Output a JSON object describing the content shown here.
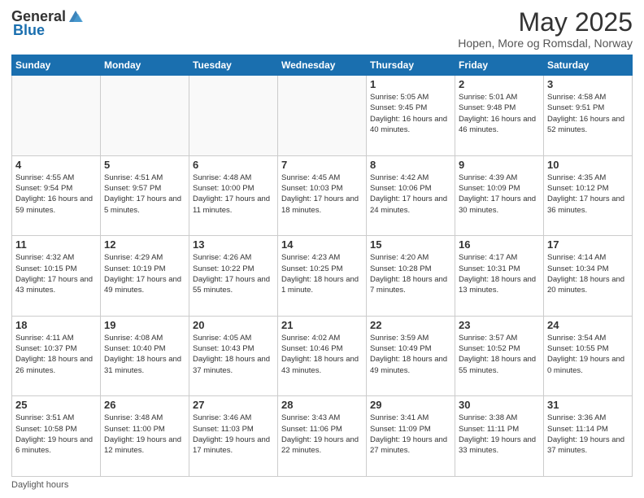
{
  "header": {
    "logo_general": "General",
    "logo_blue": "Blue",
    "title": "May 2025",
    "subtitle": "Hopen, More og Romsdal, Norway"
  },
  "calendar": {
    "days_of_week": [
      "Sunday",
      "Monday",
      "Tuesday",
      "Wednesday",
      "Thursday",
      "Friday",
      "Saturday"
    ],
    "weeks": [
      [
        {
          "day": "",
          "info": ""
        },
        {
          "day": "",
          "info": ""
        },
        {
          "day": "",
          "info": ""
        },
        {
          "day": "",
          "info": ""
        },
        {
          "day": "1",
          "info": "Sunrise: 5:05 AM\nSunset: 9:45 PM\nDaylight: 16 hours\nand 40 minutes."
        },
        {
          "day": "2",
          "info": "Sunrise: 5:01 AM\nSunset: 9:48 PM\nDaylight: 16 hours\nand 46 minutes."
        },
        {
          "day": "3",
          "info": "Sunrise: 4:58 AM\nSunset: 9:51 PM\nDaylight: 16 hours\nand 52 minutes."
        }
      ],
      [
        {
          "day": "4",
          "info": "Sunrise: 4:55 AM\nSunset: 9:54 PM\nDaylight: 16 hours\nand 59 minutes."
        },
        {
          "day": "5",
          "info": "Sunrise: 4:51 AM\nSunset: 9:57 PM\nDaylight: 17 hours\nand 5 minutes."
        },
        {
          "day": "6",
          "info": "Sunrise: 4:48 AM\nSunset: 10:00 PM\nDaylight: 17 hours\nand 11 minutes."
        },
        {
          "day": "7",
          "info": "Sunrise: 4:45 AM\nSunset: 10:03 PM\nDaylight: 17 hours\nand 18 minutes."
        },
        {
          "day": "8",
          "info": "Sunrise: 4:42 AM\nSunset: 10:06 PM\nDaylight: 17 hours\nand 24 minutes."
        },
        {
          "day": "9",
          "info": "Sunrise: 4:39 AM\nSunset: 10:09 PM\nDaylight: 17 hours\nand 30 minutes."
        },
        {
          "day": "10",
          "info": "Sunrise: 4:35 AM\nSunset: 10:12 PM\nDaylight: 17 hours\nand 36 minutes."
        }
      ],
      [
        {
          "day": "11",
          "info": "Sunrise: 4:32 AM\nSunset: 10:15 PM\nDaylight: 17 hours\nand 43 minutes."
        },
        {
          "day": "12",
          "info": "Sunrise: 4:29 AM\nSunset: 10:19 PM\nDaylight: 17 hours\nand 49 minutes."
        },
        {
          "day": "13",
          "info": "Sunrise: 4:26 AM\nSunset: 10:22 PM\nDaylight: 17 hours\nand 55 minutes."
        },
        {
          "day": "14",
          "info": "Sunrise: 4:23 AM\nSunset: 10:25 PM\nDaylight: 18 hours\nand 1 minute."
        },
        {
          "day": "15",
          "info": "Sunrise: 4:20 AM\nSunset: 10:28 PM\nDaylight: 18 hours\nand 7 minutes."
        },
        {
          "day": "16",
          "info": "Sunrise: 4:17 AM\nSunset: 10:31 PM\nDaylight: 18 hours\nand 13 minutes."
        },
        {
          "day": "17",
          "info": "Sunrise: 4:14 AM\nSunset: 10:34 PM\nDaylight: 18 hours\nand 20 minutes."
        }
      ],
      [
        {
          "day": "18",
          "info": "Sunrise: 4:11 AM\nSunset: 10:37 PM\nDaylight: 18 hours\nand 26 minutes."
        },
        {
          "day": "19",
          "info": "Sunrise: 4:08 AM\nSunset: 10:40 PM\nDaylight: 18 hours\nand 31 minutes."
        },
        {
          "day": "20",
          "info": "Sunrise: 4:05 AM\nSunset: 10:43 PM\nDaylight: 18 hours\nand 37 minutes."
        },
        {
          "day": "21",
          "info": "Sunrise: 4:02 AM\nSunset: 10:46 PM\nDaylight: 18 hours\nand 43 minutes."
        },
        {
          "day": "22",
          "info": "Sunrise: 3:59 AM\nSunset: 10:49 PM\nDaylight: 18 hours\nand 49 minutes."
        },
        {
          "day": "23",
          "info": "Sunrise: 3:57 AM\nSunset: 10:52 PM\nDaylight: 18 hours\nand 55 minutes."
        },
        {
          "day": "24",
          "info": "Sunrise: 3:54 AM\nSunset: 10:55 PM\nDaylight: 19 hours\nand 0 minutes."
        }
      ],
      [
        {
          "day": "25",
          "info": "Sunrise: 3:51 AM\nSunset: 10:58 PM\nDaylight: 19 hours\nand 6 minutes."
        },
        {
          "day": "26",
          "info": "Sunrise: 3:48 AM\nSunset: 11:00 PM\nDaylight: 19 hours\nand 12 minutes."
        },
        {
          "day": "27",
          "info": "Sunrise: 3:46 AM\nSunset: 11:03 PM\nDaylight: 19 hours\nand 17 minutes."
        },
        {
          "day": "28",
          "info": "Sunrise: 3:43 AM\nSunset: 11:06 PM\nDaylight: 19 hours\nand 22 minutes."
        },
        {
          "day": "29",
          "info": "Sunrise: 3:41 AM\nSunset: 11:09 PM\nDaylight: 19 hours\nand 27 minutes."
        },
        {
          "day": "30",
          "info": "Sunrise: 3:38 AM\nSunset: 11:11 PM\nDaylight: 19 hours\nand 33 minutes."
        },
        {
          "day": "31",
          "info": "Sunrise: 3:36 AM\nSunset: 11:14 PM\nDaylight: 19 hours\nand 37 minutes."
        }
      ]
    ]
  },
  "footer": {
    "note": "Daylight hours"
  }
}
